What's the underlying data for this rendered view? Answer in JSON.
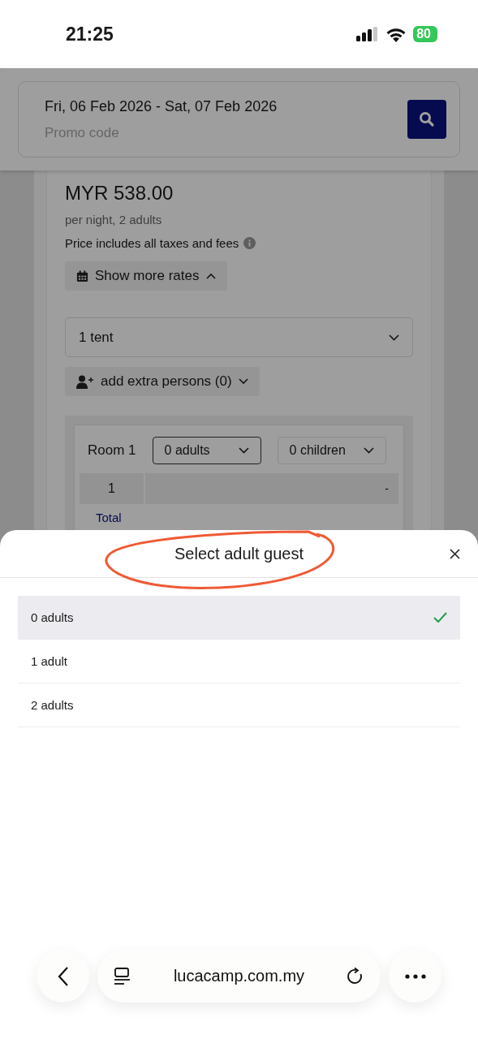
{
  "status_bar": {
    "time": "21:25",
    "battery": "80"
  },
  "search_bar": {
    "dates": "Fri, 06 Feb 2026 - Sat, 07 Feb 2026",
    "promo_placeholder": "Promo code"
  },
  "rate": {
    "price": "MYR 538.00",
    "per_night": "per night, 2 adults",
    "taxes_note": "Price includes all taxes and fees",
    "more_rates_button": "Show more rates",
    "expanded": true
  },
  "unit_select": {
    "value": "1 tent"
  },
  "extra_persons_button": "add extra persons (0)",
  "room": {
    "label": "Room 1",
    "adults": "0 adults",
    "children": "0 children",
    "rows": [
      {
        "column_1": "1",
        "column_2": "-"
      }
    ],
    "total": "Total"
  },
  "sheet": {
    "title": "Select adult guest",
    "options": [
      {
        "label": "0 adults",
        "selected": true
      },
      {
        "label": "1 adult",
        "selected": false
      },
      {
        "label": "2 adults",
        "selected": false
      }
    ]
  },
  "browser": {
    "url": "lucacamp.com.my"
  }
}
